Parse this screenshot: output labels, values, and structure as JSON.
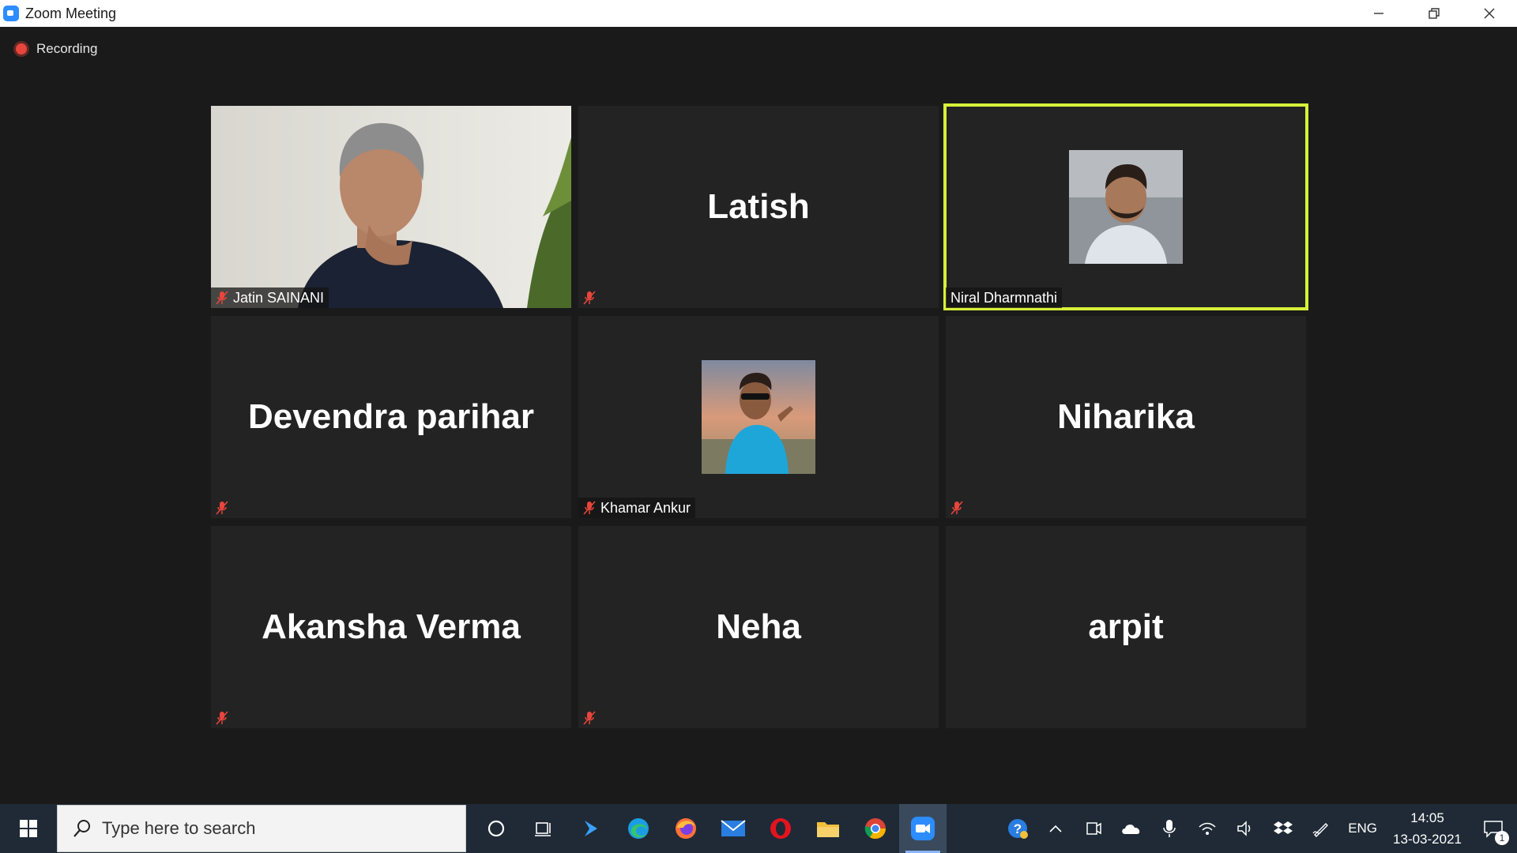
{
  "window": {
    "title": "Zoom Meeting"
  },
  "meeting": {
    "recording_label": "Recording",
    "tiles": [
      {
        "name": "Jatin SAINANI",
        "big_name": "",
        "muted": true
      },
      {
        "name": "",
        "big_name": "Latish",
        "muted": true
      },
      {
        "name": "Niral Dharmnathi",
        "big_name": "",
        "muted": false,
        "active_speaker": true
      },
      {
        "name": "",
        "big_name": "Devendra parihar",
        "muted": true
      },
      {
        "name": "Khamar Ankur",
        "big_name": "",
        "muted": true
      },
      {
        "name": "",
        "big_name": "Niharika",
        "muted": true
      },
      {
        "name": "",
        "big_name": "Akansha Verma",
        "muted": true
      },
      {
        "name": "",
        "big_name": "Neha",
        "muted": true
      },
      {
        "name": "",
        "big_name": "arpit",
        "muted": false
      }
    ]
  },
  "taskbar": {
    "search_placeholder": "Type here to search",
    "language": "ENG",
    "time": "14:05",
    "date": "13-03-2021",
    "notification_count": "1",
    "accent_color": "#2d8cff",
    "active_speaker_color": "#d6f03a"
  }
}
